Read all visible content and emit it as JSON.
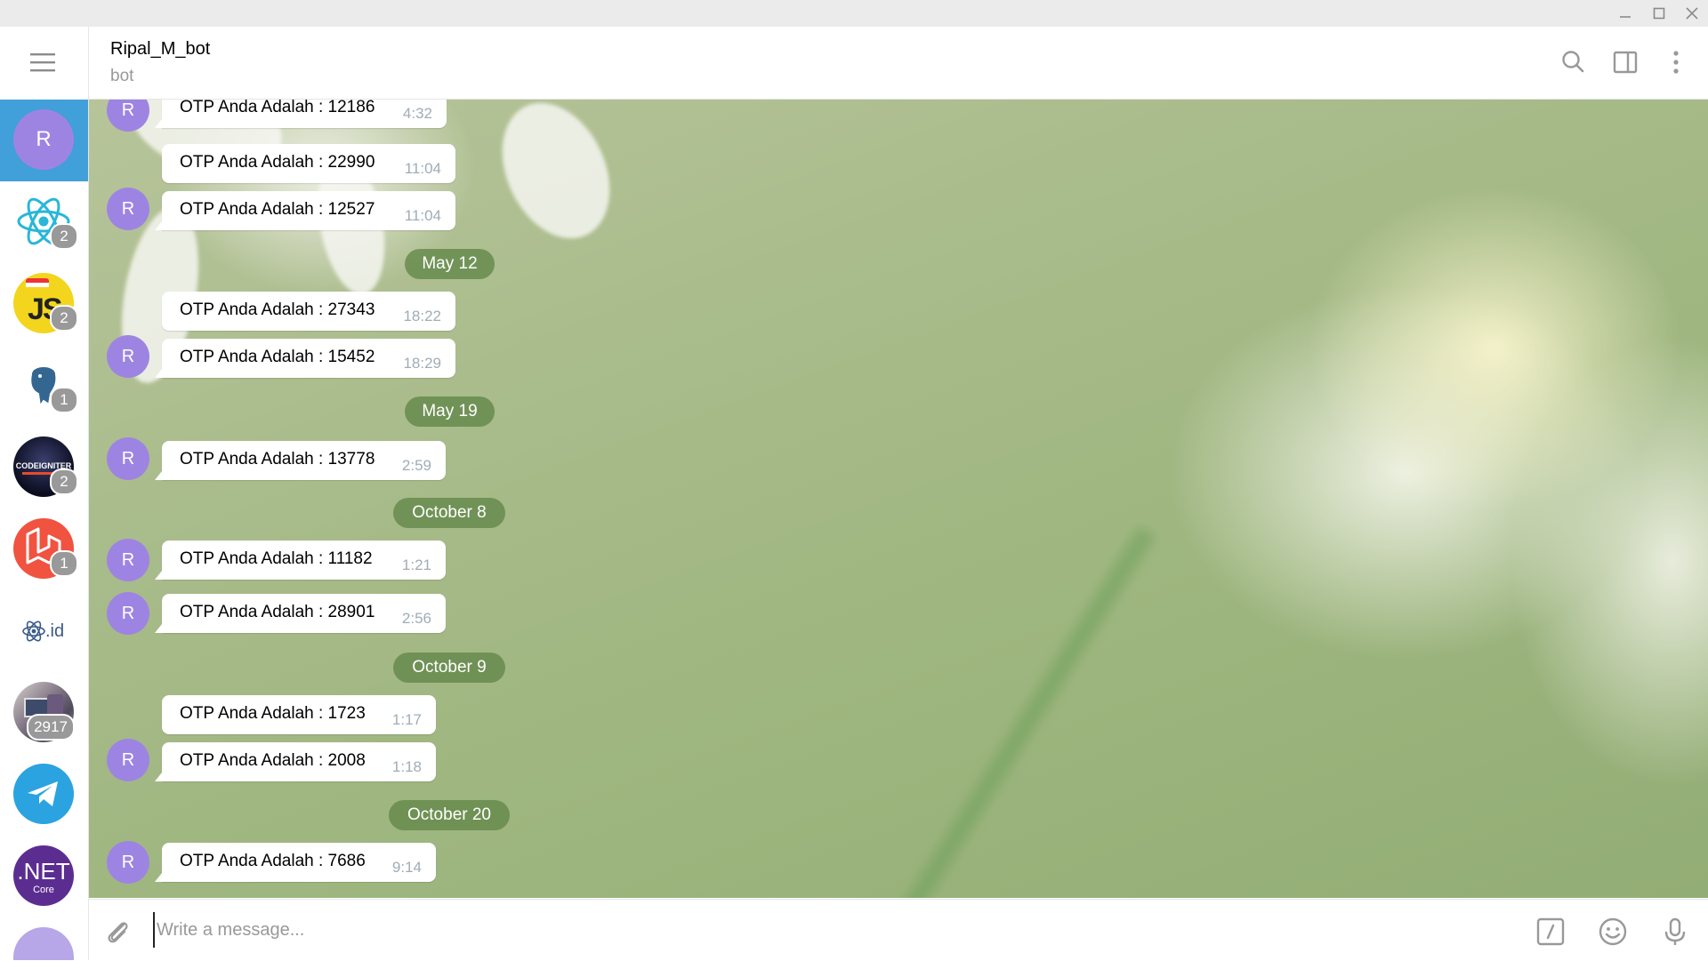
{
  "window": {
    "controls": [
      "minimize-icon",
      "maximize-icon",
      "close-icon"
    ]
  },
  "sidebar": {
    "folders": [
      {
        "name": "bot-profile",
        "initial": "R",
        "color": "#9d84e3",
        "active": true,
        "badge": ""
      },
      {
        "name": "react-group",
        "icon": "react-logo-icon",
        "badge": "2"
      },
      {
        "name": "js-group",
        "label": "JS",
        "color": "#f7df1e",
        "badge": "2"
      },
      {
        "name": "postgres-group",
        "icon": "elephant-icon",
        "badge": "1"
      },
      {
        "name": "codeigniter-group",
        "label": "CODEIGNITER",
        "badge": "2"
      },
      {
        "name": "laravel-group",
        "icon": "laravel-logo-icon",
        "badge": "1"
      },
      {
        "name": "reactid-group",
        "label": ".id",
        "badge": ""
      },
      {
        "name": "photo-group",
        "icon": "photo-icon",
        "badge": "2917"
      },
      {
        "name": "telegram-channel",
        "icon": "paper-plane-icon",
        "color": "#2aa3e0",
        "badge": ""
      },
      {
        "name": "dotnet-group",
        "label": ".NET",
        "sublabel": "Core",
        "color": "#5c2d91",
        "badge": ""
      }
    ]
  },
  "header": {
    "title": "Ripal_M_bot",
    "subtitle": "bot",
    "icons": [
      "search-icon",
      "sidebar-toggle-icon",
      "more-vertical-icon"
    ]
  },
  "messages": [
    {
      "text": "OTP Anda Adalah : 12186",
      "time": "4:32"
    },
    {
      "text": "OTP Anda Adalah : 22990",
      "time": "11:04"
    },
    {
      "text": "OTP Anda Adalah : 12527",
      "time": "11:04"
    },
    {
      "date": "May 12"
    },
    {
      "text": "OTP Anda Adalah : 27343",
      "time": "18:22"
    },
    {
      "text": "OTP Anda Adalah : 15452",
      "time": "18:29"
    },
    {
      "date": "May 19"
    },
    {
      "text": "OTP Anda Adalah : 13778",
      "time": "2:59"
    },
    {
      "date": "October 8"
    },
    {
      "text": "OTP Anda Adalah : 11182",
      "time": "1:21"
    },
    {
      "text": "OTP Anda Adalah : 28901",
      "time": "2:56"
    },
    {
      "date": "October 9"
    },
    {
      "text": "OTP Anda Adalah : 1723",
      "time": "1:17"
    },
    {
      "text": "OTP Anda Adalah : 2008",
      "time": "1:18"
    },
    {
      "date": "October 20"
    },
    {
      "text": "OTP Anda Adalah : 7686",
      "time": "9:14"
    }
  ],
  "sender_initial": "R",
  "composer": {
    "placeholder": "Write a message...",
    "icons": [
      "attach-icon",
      "bot-command-icon",
      "emoji-icon",
      "microphone-icon"
    ]
  }
}
